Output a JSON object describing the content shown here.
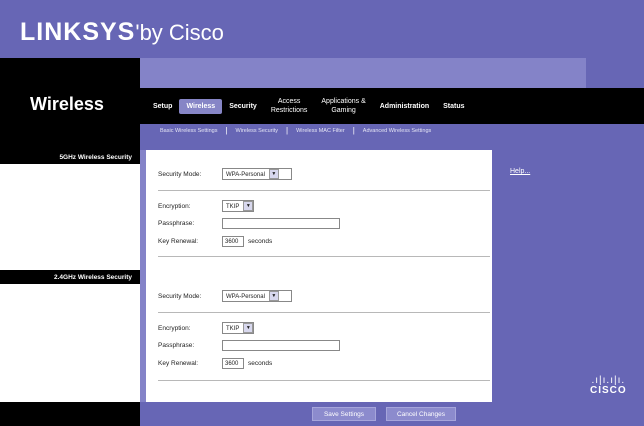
{
  "brand": {
    "logo_mark": "LINKSYS",
    "logo_suffix": "by Cisco"
  },
  "section_title": "Wireless",
  "tabs": [
    {
      "label": "Setup"
    },
    {
      "label": "Wireless"
    },
    {
      "label": "Security"
    },
    {
      "label": "Access\nRestrictions"
    },
    {
      "label": "Applications &\nGaming"
    },
    {
      "label": "Administration"
    },
    {
      "label": "Status"
    }
  ],
  "subnav": [
    "Basic Wireless Settings",
    "Wireless Security",
    "Wireless MAC Filter",
    "Advanced Wireless Settings"
  ],
  "sections": [
    {
      "label": "5GHz Wireless Security",
      "security_mode_label": "Security Mode:",
      "security_mode_value": "WPA-Personal",
      "encryption_label": "Encryption:",
      "encryption_value": "TKIP",
      "passphrase_label": "Passphrase:",
      "key_renewal_label": "Key Renewal:",
      "key_renewal_value": "3600",
      "key_renewal_unit": "seconds"
    },
    {
      "label": "2.4GHz Wireless Security",
      "security_mode_label": "Security Mode:",
      "security_mode_value": "WPA-Personal",
      "encryption_label": "Encryption:",
      "encryption_value": "TKIP",
      "passphrase_label": "Passphrase:",
      "key_renewal_label": "Key Renewal:",
      "key_renewal_value": "3600",
      "key_renewal_unit": "seconds"
    }
  ],
  "help": {
    "label": "Help..."
  },
  "footer": {
    "save_label": "Save Settings",
    "cancel_label": "Cancel Changes",
    "cisco_word": "CISCO"
  },
  "colors": {
    "brand_purple": "#6766b5",
    "panel_black": "#000000",
    "light_purple": "#8483c8"
  },
  "icons": [
    "chevron-down-icon",
    "cisco-logo-icon"
  ]
}
